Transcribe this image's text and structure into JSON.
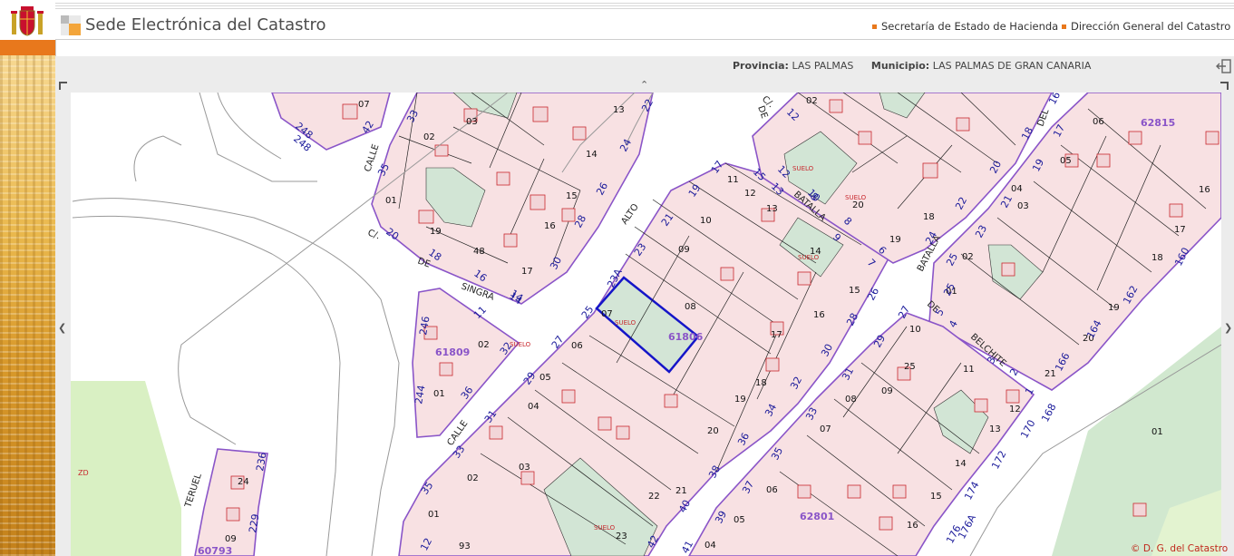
{
  "header": {
    "site_title": "Sede Electrónica del Catastro",
    "links": [
      "Secretaría de Estado de Hacienda",
      "Dirección General del Catastro"
    ]
  },
  "info": {
    "provincia_label": "Provincia:",
    "provincia_value": "LAS PALMAS",
    "municipio_label": "Municipio:",
    "municipio_value": "LAS PALMAS DE GRAN CANARIA"
  },
  "map": {
    "copyright": "© D. G. del Catastro",
    "labels": {
      "parcel_selected": "61806",
      "parcel_ne": "62815",
      "parcel_se": "62801",
      "parcel_w": "60793",
      "parcel_island": "61809",
      "street_calle_1": "CALLE",
      "street_calle_2": "CALLE",
      "street_alto": "ALTO",
      "street_batalla_1": "BATALLA",
      "street_batalla_2": "BATALLA",
      "street_del": "DEL",
      "street_belchite": "BELCHITE",
      "street_teruel": "TERUEL",
      "street_singra": "SINGRA",
      "street_de_1": "DE",
      "street_de_2": "DE",
      "street_de_3": "DE",
      "street_c_1": "C/.",
      "street_c_2": "C/.",
      "suelo_1": "SUELO",
      "suelo_2": "SUELO",
      "suelo_3": "SUELO",
      "suelo_4": "SUELO",
      "suelo_5": "SUELO",
      "suelo_6": "SUELO",
      "zd": "ZD",
      "n_07a": "07",
      "n_03a": "03",
      "n_02a": "02",
      "n_13a": "13",
      "n_14a": "14",
      "n_15a": "15",
      "n_16a": "16",
      "n_01a": "01",
      "n_19a": "19",
      "n_48": "48",
      "n_17a": "17",
      "n_09a": "09",
      "n_08a": "08",
      "n_07b": "07",
      "n_06a": "06",
      "n_05a": "05",
      "n_04a": "04",
      "n_02b": "02",
      "n_01b": "01",
      "n_03b": "03",
      "n_22": "22",
      "n_21": "21",
      "n_20a": "20",
      "n_19b": "19",
      "n_18a": "18",
      "n_17b": "17",
      "n_16b": "16",
      "n_15b": "15",
      "n_14b": "14",
      "n_13b": "13",
      "n_12a": "12",
      "n_11a": "11",
      "n_10a": "10",
      "n_20b": "20",
      "n_18b": "18",
      "n_19c": "19",
      "n_02c": "02",
      "n_04b": "04",
      "n_03c": "03",
      "n_06b": "06",
      "n_05b": "05",
      "n_16c": "16",
      "n_17c": "17",
      "n_18c": "18",
      "n_01c": "01",
      "n_02d": "02",
      "n_19d": "19",
      "n_20c": "20",
      "n_21b": "21",
      "n_10b": "10",
      "n_25": "25",
      "n_11b": "11",
      "n_12b": "12",
      "n_13c": "13",
      "n_09b": "09",
      "n_08b": "08",
      "n_07c": "07",
      "n_14c": "14",
      "n_15c": "15",
      "n_16d": "16",
      "n_06c": "06",
      "n_05c": "05",
      "n_04c": "04",
      "n_02e": "02",
      "n_01d": "01",
      "n_01e": "01",
      "n_02f": "02",
      "n_24": "24",
      "n_09c": "09",
      "n_93": "93",
      "n_23": "23",
      "n_01f": "01",
      "s_248a": "248",
      "s_248b": "248",
      "s_42": "42",
      "s_33": "33",
      "s_35": "35",
      "s_20": "20",
      "s_18": "18",
      "s_16": "16",
      "s_14": "14",
      "s_22": "22",
      "s_24": "24",
      "s_26": "26",
      "s_28": "28",
      "s_30": "30",
      "s_23a": "23A",
      "s_23": "23",
      "s_21": "21",
      "s_19": "19",
      "s_17": "17",
      "s_25": "25",
      "s_27": "27",
      "s_29": "29",
      "s_31": "31",
      "s_33b": "33",
      "s_35b": "35",
      "s_11": "11",
      "s_32a": "32",
      "s_36a": "36",
      "s_244": "244",
      "s_246": "246",
      "s_15": "15",
      "s_13": "13",
      "s_12": "12",
      "s_10": "10",
      "s_8": "8",
      "s_6": "6",
      "s_9": "9",
      "s_7": "7",
      "s_26b": "26",
      "s_28b": "28",
      "s_30b": "30",
      "s_32b": "32",
      "s_34": "34",
      "s_36b": "36",
      "s_38": "38",
      "s_40": "40",
      "s_42b": "42",
      "s_25b": "25",
      "s_27b": "27",
      "s_29b": "29",
      "s_31b": "31",
      "s_33c": "33",
      "s_35c": "35",
      "s_37": "37",
      "s_39": "39",
      "s_41": "41",
      "s_16b": "16",
      "s_18b": "18",
      "s_20b": "20",
      "s_22b": "22",
      "s_24b": "24",
      "s_17b": "17",
      "s_19b": "19",
      "s_21b": "21",
      "s_23b": "23",
      "s_25c": "25",
      "s_12b": "12",
      "s_14b": "14",
      "s_160": "160",
      "s_162": "162",
      "s_164": "164",
      "s_166": "166",
      "s_170": "170",
      "s_168": "168",
      "s_172": "172",
      "s_174": "174",
      "s_176a": "176A",
      "s_176": "176",
      "s_5": "5",
      "s_4": "4",
      "s_3": "3",
      "s_2": "2",
      "s_1": "1",
      "s_236": "236",
      "s_229": "229",
      "s_12c": "12",
      "s_8b": "8"
    }
  }
}
